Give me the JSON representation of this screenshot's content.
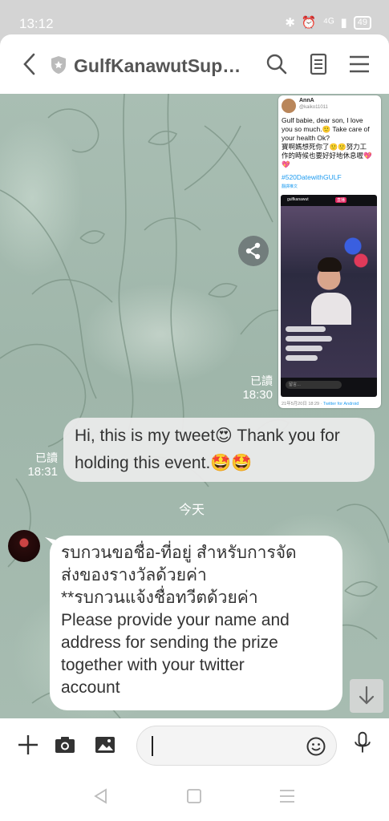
{
  "status_bar": {
    "time": "13:12",
    "signal": "⁴ᴳ",
    "battery": "49"
  },
  "header": {
    "title": "GulfKanawutSupport"
  },
  "tweet_card": {
    "user_name": "AnnA",
    "user_handle": "@kaiko11011",
    "text_lines": [
      "Gulf babie, dear son, I love",
      "you so much.🙂 Take care of",
      "your health Ok?",
      "寶啊媽想死你了🙂🙂努力工",
      "作的時候也要好好地休息喔💖",
      "💖"
    ],
    "hashtag": "#520DatewithGULF",
    "translate_label": "翻譯推文",
    "live_header": "gulfkanawut",
    "live_tag": "直播",
    "live_comment_box": "留言…",
    "footer_date": "21年5月20日 18:29 · ",
    "footer_source": "Twitter for Android"
  },
  "messages": {
    "tweet_read": "已讀",
    "tweet_time": "18:30",
    "outgoing_text": "Hi, this is my tweet😍 Thank you for holding this event.🤩🤩",
    "outgoing_read": "已讀",
    "outgoing_time": "18:31",
    "day_separator": "今天",
    "incoming_lines": [
      "รบกวนขอชื่อ-ที่อยู่ สำหรับการจัด",
      "ส่งของรางวัลด้วยค่า",
      "**รบกวนแจ้งชื่อทวีตด้วยค่า",
      "Please provide your name and",
      "address for sending the prize",
      "together with your twitter",
      "account"
    ]
  },
  "input": {
    "placeholder": ""
  },
  "colors": {
    "chat_bg": "#a9beb3",
    "header_text": "#555555",
    "hashtag": "#1d9bf0"
  }
}
